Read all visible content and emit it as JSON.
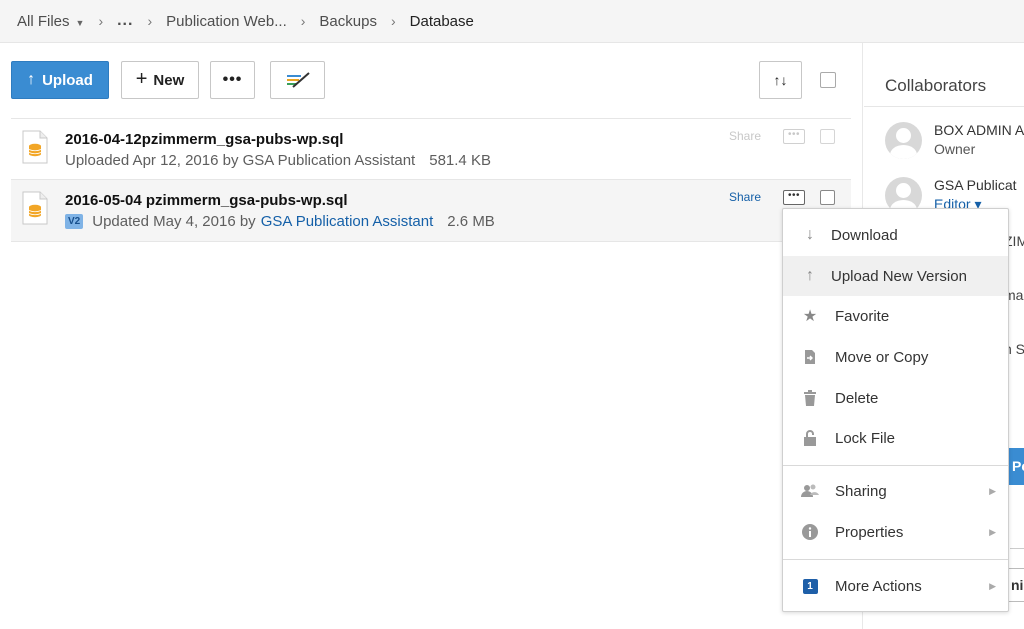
{
  "breadcrumb": {
    "all_files": "All Files",
    "ellipsis": "...",
    "items": [
      "Publication Web...",
      "Backups"
    ],
    "current": "Database"
  },
  "toolbar": {
    "upload_label": "Upload",
    "new_label": "New",
    "more_label": "•••",
    "sort_label": "↑↓"
  },
  "files": [
    {
      "name": "2016-04-12pzimmerm_gsa-pubs-wp.sql",
      "meta_prefix": "Uploaded Apr 12, 2016 by GSA Publication Assistant",
      "size": "581.4 KB",
      "share": "Share"
    },
    {
      "name": "2016-05-04 pzimmerm_gsa-pubs-wp.sql",
      "version": "V2",
      "meta_prefix": "Updated May 4, 2016 by",
      "meta_link": "GSA Publication Assistant",
      "size": "2.6 MB",
      "share": "Share"
    }
  ],
  "sidebar": {
    "title": "Collaborators",
    "collaborators": [
      {
        "name": "BOX ADMIN A",
        "role": "Owner"
      },
      {
        "name": "GSA Publicat",
        "role": "Editor ▾"
      }
    ],
    "fragments": [
      "ZIM",
      "ma",
      "n S",
      "Pe",
      "nis"
    ]
  },
  "menu": {
    "items": [
      {
        "label": "Download",
        "icon": "download-icon"
      },
      {
        "label": "Upload New Version",
        "icon": "upload-icon"
      },
      {
        "label": "Favorite",
        "icon": "star-icon"
      },
      {
        "label": "Move or Copy",
        "icon": "move-copy-icon"
      },
      {
        "label": "Delete",
        "icon": "trash-icon"
      },
      {
        "label": "Lock File",
        "icon": "lock-icon"
      }
    ],
    "submenus": [
      {
        "label": "Sharing",
        "icon": "people-icon"
      },
      {
        "label": "Properties",
        "icon": "info-icon"
      }
    ],
    "more": {
      "label": "More Actions",
      "badge": "1"
    }
  }
}
